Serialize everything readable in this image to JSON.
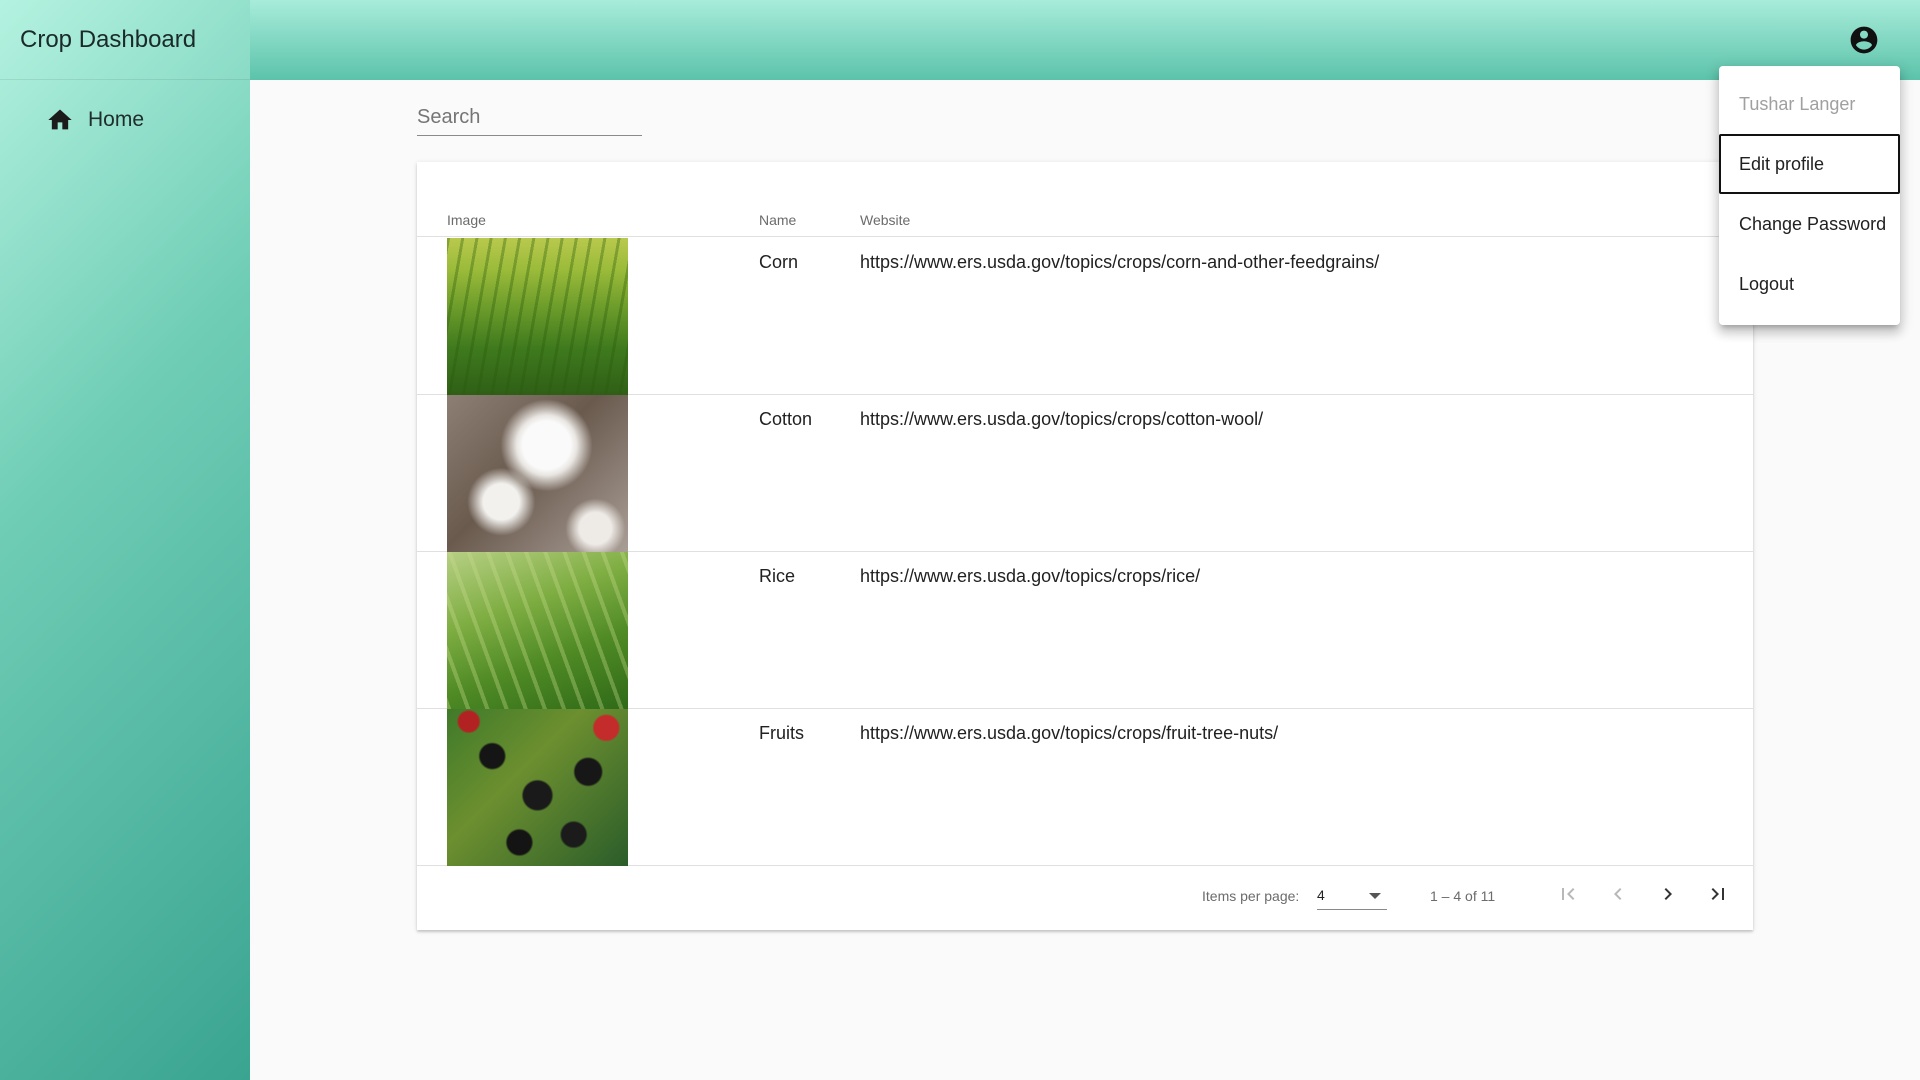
{
  "app": {
    "title": "Crop Dashboard"
  },
  "sidebar": {
    "items": [
      {
        "label": "Home",
        "icon": "home-icon"
      }
    ]
  },
  "toolbar": {
    "account_icon": "account-circle-icon"
  },
  "search": {
    "placeholder": "Search",
    "value": ""
  },
  "table": {
    "columns": [
      "Image",
      "Name",
      "Website"
    ],
    "rows": [
      {
        "name": "Corn",
        "website": "https://www.ers.usda.gov/topics/crops/corn-and-other-feedgrains/",
        "image": "corn-field-image"
      },
      {
        "name": "Cotton",
        "website": "https://www.ers.usda.gov/topics/crops/cotton-wool/",
        "image": "cotton-boll-image"
      },
      {
        "name": "Rice",
        "website": "https://www.ers.usda.gov/topics/crops/rice/",
        "image": "rice-plant-image"
      },
      {
        "name": "Fruits",
        "website": "https://www.ers.usda.gov/topics/crops/fruit-tree-nuts/",
        "image": "blackberries-image"
      }
    ]
  },
  "paginator": {
    "items_per_page_label": "Items per page:",
    "items_per_page_value": "4",
    "range_label": "1 – 4 of 11"
  },
  "account_menu": {
    "user_name": "Tushar Langer",
    "items": [
      "Edit profile",
      "Change Password",
      "Logout"
    ]
  },
  "colors": {
    "sidebar_gradient_start": "#b4f2e0",
    "sidebar_gradient_end": "#3aa491",
    "toolbar_gradient_start": "#a8ecdb",
    "toolbar_gradient_end": "#5cc3aa",
    "background": "#fafafa"
  }
}
